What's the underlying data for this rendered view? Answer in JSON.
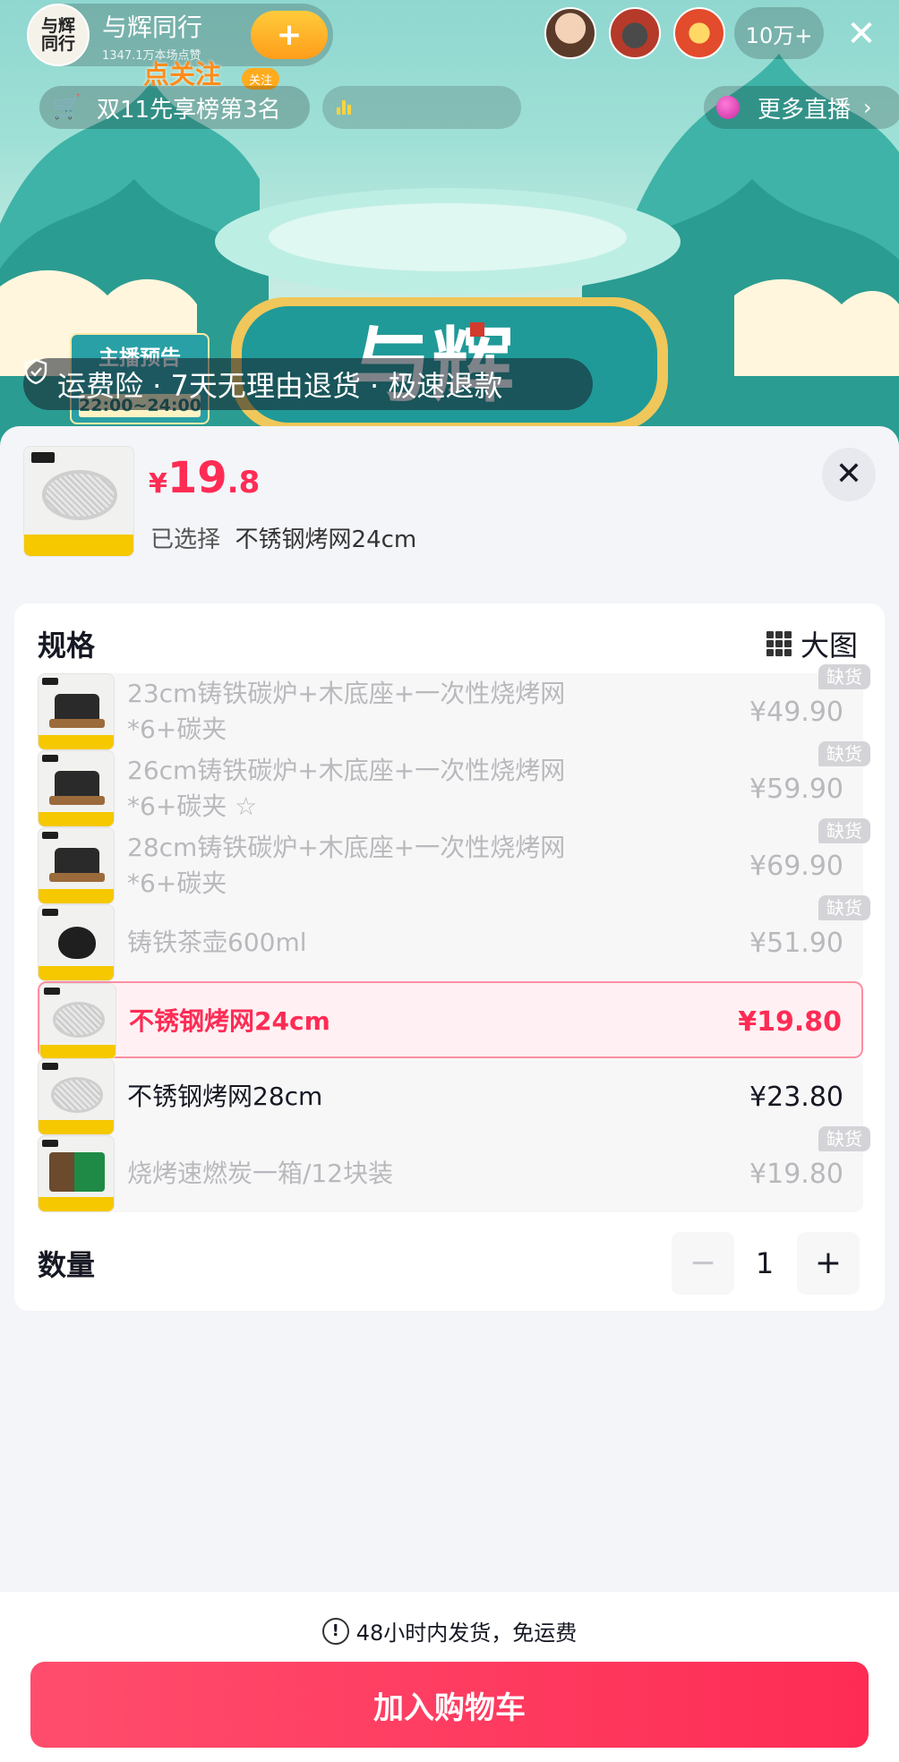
{
  "live": {
    "streamer_name": "与辉同行",
    "streamer_logo_text": "与辉同行",
    "likes_text": "1347.1万本场点赞",
    "follow_icon": "plus-heart-icon",
    "follow_tip": "点关注",
    "follow_tip_badge": "关注",
    "viewer_count": "10万+",
    "rank_text": "双11先享榜第3名",
    "more_live_text": "更多直播",
    "preview_tag_title": "主播预告",
    "preview_tag_time": "22:00~24:00",
    "service_text": "运费险 · 7天无理由退货 · 极速退款"
  },
  "product": {
    "price_currency": "¥",
    "price_int": "19",
    "price_dec": ".8",
    "selected_label": "已选择",
    "selected_value": "不锈钢烤网24cm"
  },
  "spec": {
    "title": "规格",
    "big_image_label": "大图",
    "out_of_stock_label": "缺货",
    "options": [
      {
        "name": "23cm铸铁碳炉+木底座+一次性烧烤网*6+碳夹",
        "price": "¥49.90",
        "state": "oos",
        "thumb": "stove"
      },
      {
        "name": "26cm铸铁碳炉+木底座+一次性烧烤网*6+碳夹 ☆",
        "price": "¥59.90",
        "state": "oos",
        "thumb": "stove"
      },
      {
        "name": "28cm铸铁碳炉+木底座+一次性烧烤网*6+碳夹",
        "price": "¥69.90",
        "state": "oos",
        "thumb": "stove"
      },
      {
        "name": "铸铁茶壶600ml",
        "price": "¥51.90",
        "state": "oos",
        "thumb": "pot"
      },
      {
        "name": "不锈钢烤网24cm",
        "price": "¥19.80",
        "state": "selected",
        "thumb": "plate"
      },
      {
        "name": "不锈钢烤网28cm",
        "price": "¥23.80",
        "state": "available",
        "thumb": "plate"
      },
      {
        "name": "烧烤速燃炭一箱/12块装",
        "price": "¥19.80",
        "state": "oos",
        "thumb": "coal"
      }
    ]
  },
  "quantity": {
    "label": "数量",
    "value": "1",
    "minus": "−",
    "plus": "+"
  },
  "footer": {
    "ship_note": "48小时内发货，免运费",
    "add_to_cart": "加入购物车"
  },
  "colors": {
    "accent": "#fe2c55",
    "follow_gold": "#ffb21d",
    "oos_badge": "#d4d4d8"
  }
}
